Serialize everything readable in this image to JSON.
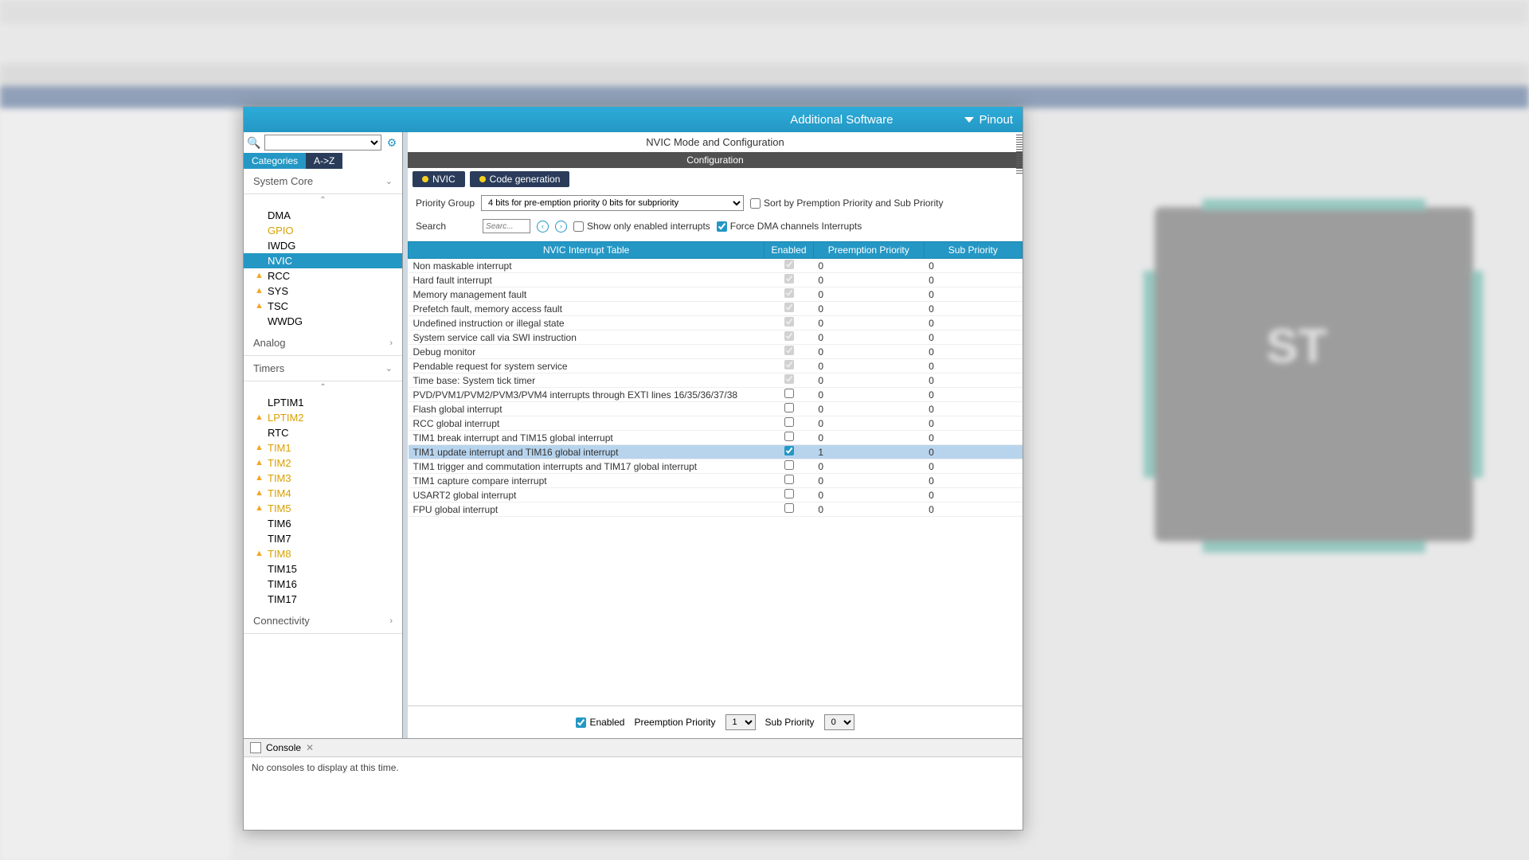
{
  "header": {
    "additional_software": "Additional Software",
    "pinout": "Pinout"
  },
  "left": {
    "tabs": {
      "categories": "Categories",
      "az": "A->Z"
    },
    "sections": {
      "system_core": "System Core",
      "analog": "Analog",
      "timers": "Timers",
      "connectivity": "Connectivity"
    },
    "system_items": [
      "DMA",
      "GPIO",
      "IWDG",
      "NVIC",
      "RCC",
      "SYS",
      "TSC",
      "WWDG"
    ],
    "timer_items": [
      "LPTIM1",
      "LPTIM2",
      "RTC",
      "TIM1",
      "TIM2",
      "TIM3",
      "TIM4",
      "TIM5",
      "TIM6",
      "TIM7",
      "TIM8",
      "TIM15",
      "TIM16",
      "TIM17"
    ]
  },
  "right": {
    "mode_title": "NVIC Mode and Configuration",
    "config_title": "Configuration",
    "tabs": {
      "nvic": "NVIC",
      "codegen": "Code generation"
    },
    "priority_group_label": "Priority Group",
    "priority_group_value": "4 bits for pre-emption priority 0 bits for subpriority",
    "sort_label": "Sort by Premption Priority and Sub Priority",
    "search_label": "Search",
    "search_placeholder": "Searc...",
    "show_only_label": "Show only enabled interrupts",
    "force_dma_label": "Force DMA channels Interrupts",
    "table": {
      "headers": [
        "NVIC Interrupt Table",
        "Enabled",
        "Preemption Priority",
        "Sub Priority"
      ],
      "rows": [
        {
          "name": "Non maskable interrupt",
          "en": true,
          "locked": true,
          "pp": "0",
          "sp": "0"
        },
        {
          "name": "Hard fault interrupt",
          "en": true,
          "locked": true,
          "pp": "0",
          "sp": "0"
        },
        {
          "name": "Memory management fault",
          "en": true,
          "locked": true,
          "pp": "0",
          "sp": "0"
        },
        {
          "name": "Prefetch fault, memory access fault",
          "en": true,
          "locked": true,
          "pp": "0",
          "sp": "0"
        },
        {
          "name": "Undefined instruction or illegal state",
          "en": true,
          "locked": true,
          "pp": "0",
          "sp": "0"
        },
        {
          "name": "System service call via SWI instruction",
          "en": true,
          "locked": true,
          "pp": "0",
          "sp": "0"
        },
        {
          "name": "Debug monitor",
          "en": true,
          "locked": true,
          "pp": "0",
          "sp": "0"
        },
        {
          "name": "Pendable request for system service",
          "en": true,
          "locked": true,
          "pp": "0",
          "sp": "0"
        },
        {
          "name": "Time base: System tick timer",
          "en": true,
          "locked": true,
          "pp": "0",
          "sp": "0"
        },
        {
          "name": "PVD/PVM1/PVM2/PVM3/PVM4 interrupts through EXTI lines 16/35/36/37/38",
          "en": false,
          "locked": false,
          "pp": "0",
          "sp": "0"
        },
        {
          "name": "Flash global interrupt",
          "en": false,
          "locked": false,
          "pp": "0",
          "sp": "0"
        },
        {
          "name": "RCC global interrupt",
          "en": false,
          "locked": false,
          "pp": "0",
          "sp": "0"
        },
        {
          "name": "TIM1 break interrupt and TIM15 global interrupt",
          "en": false,
          "locked": false,
          "pp": "0",
          "sp": "0"
        },
        {
          "name": "TIM1 update interrupt and TIM16 global interrupt",
          "en": true,
          "locked": false,
          "pp": "1",
          "sp": "0",
          "sel": true
        },
        {
          "name": "TIM1 trigger and commutation interrupts and TIM17 global interrupt",
          "en": false,
          "locked": false,
          "pp": "0",
          "sp": "0"
        },
        {
          "name": "TIM1 capture compare interrupt",
          "en": false,
          "locked": false,
          "pp": "0",
          "sp": "0"
        },
        {
          "name": "USART2 global interrupt",
          "en": false,
          "locked": false,
          "pp": "0",
          "sp": "0"
        },
        {
          "name": "FPU global interrupt",
          "en": false,
          "locked": false,
          "pp": "0",
          "sp": "0"
        }
      ]
    },
    "bottom": {
      "enabled_label": "Enabled",
      "pp_label": "Preemption Priority",
      "pp_value": "1",
      "sp_label": "Sub Priority",
      "sp_value": "0"
    }
  },
  "console": {
    "tab": "Console",
    "body": "No consoles to display at this time."
  }
}
